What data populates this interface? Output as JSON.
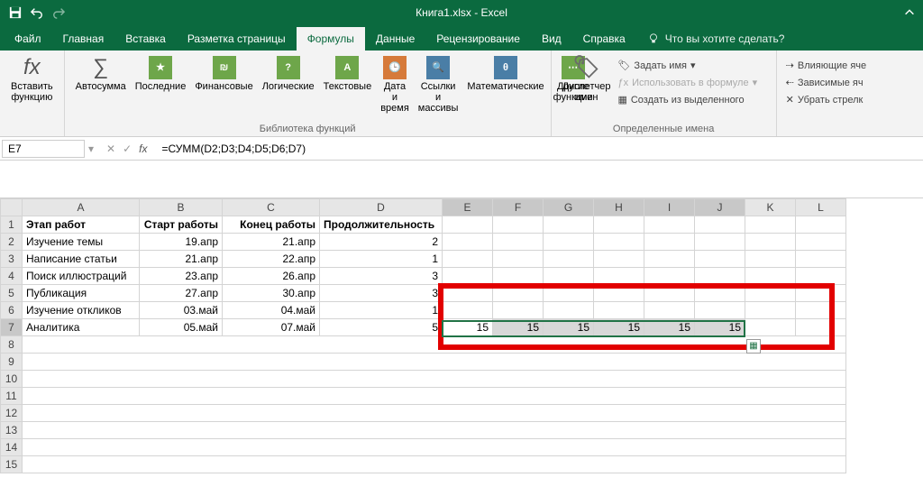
{
  "app": {
    "title": "Книга1.xlsx - Excel"
  },
  "tabs": {
    "file": "Файл",
    "home": "Главная",
    "insert": "Вставка",
    "layout": "Разметка страницы",
    "formulas": "Формулы",
    "data": "Данные",
    "review": "Рецензирование",
    "view": "Вид",
    "help": "Справка",
    "tellme": "Что вы хотите сделать?"
  },
  "ribbon": {
    "insert_fn": "Вставить\nфункцию",
    "autosum": "Автосумма",
    "recent": "Последние",
    "financial": "Финансовые",
    "logical": "Логические",
    "text": "Текстовые",
    "date": "Дата и\nвремя",
    "lookup": "Ссылки и\nмассивы",
    "math": "Математические",
    "more": "Другие\nфункции",
    "name_mgr": "Диспетчер\nимен",
    "define_name": "Задать имя",
    "use_in_formula": "Использовать в формуле",
    "create_from_sel": "Создать из выделенного",
    "trace_prec": "Влияющие яче",
    "trace_dep": "Зависимые яч",
    "remove_arrows": "Убрать стрелк",
    "lib_label": "Библиотека функций",
    "names_label": "Определенные имена"
  },
  "formula_bar": {
    "name_box": "E7",
    "formula": "=СУММ(D2;D3;D4;D5;D6;D7)"
  },
  "columns": [
    "A",
    "B",
    "C",
    "D",
    "E",
    "F",
    "G",
    "H",
    "I",
    "J",
    "K",
    "L"
  ],
  "headers": {
    "A": "Этап работ",
    "B": "Старт работы",
    "C": "Конец работы",
    "D": "Продолжительность"
  },
  "rows": [
    {
      "A": "Изучение темы",
      "B": "19.апр",
      "C": "21.апр",
      "D": "2"
    },
    {
      "A": "Написание статьи",
      "B": "21.апр",
      "C": "22.апр",
      "D": "1"
    },
    {
      "A": "Поиск иллюстраций",
      "B": "23.апр",
      "C": "26.апр",
      "D": "3"
    },
    {
      "A": "Публикация",
      "B": "27.апр",
      "C": "30.апр",
      "D": "3"
    },
    {
      "A": "Изучение откликов",
      "B": "03.май",
      "C": "04.май",
      "D": "1"
    },
    {
      "A": "Аналитика",
      "B": "05.май",
      "C": "07.май",
      "D": "5"
    }
  ],
  "row7_series": {
    "E": "15",
    "F": "15",
    "G": "15",
    "H": "15",
    "I": "15",
    "J": "15"
  },
  "selected_cell": "E7",
  "selected_range": "E7:J7"
}
